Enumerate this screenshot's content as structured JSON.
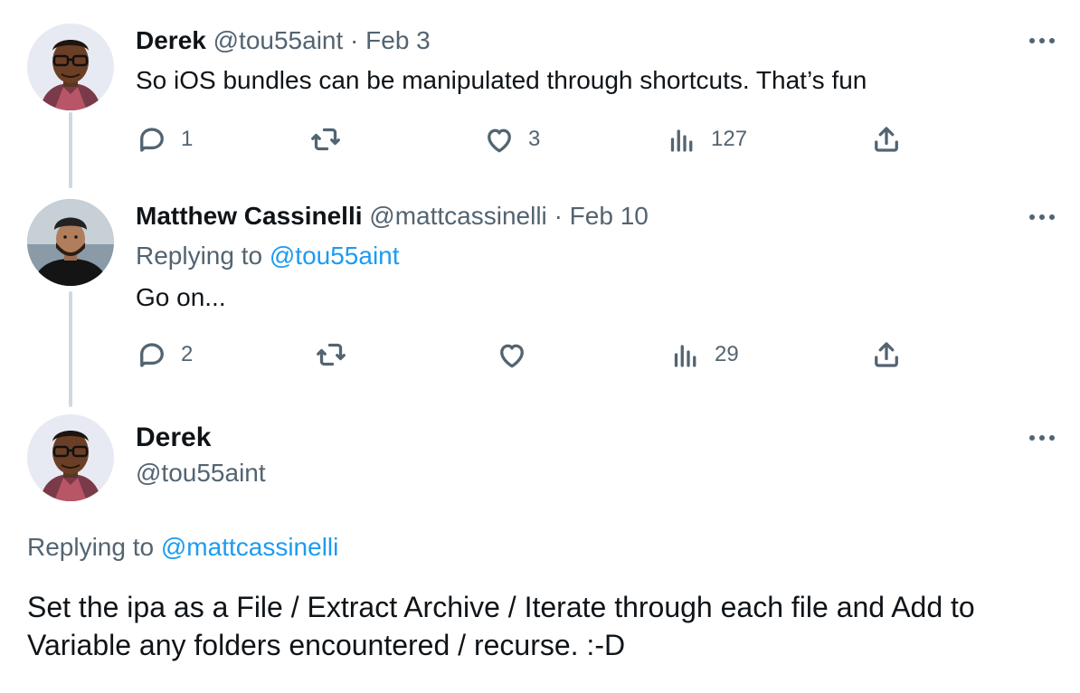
{
  "tweets": [
    {
      "name": "Derek",
      "handle": "@tou55aint",
      "separator": "·",
      "date": "Feb 3",
      "text": "So iOS bundles can be manipulated through shortcuts. That’s fun",
      "actions": {
        "replies": "1",
        "retweets": "",
        "likes": "3",
        "views": "127"
      }
    },
    {
      "name": "Matthew Cassinelli",
      "handle": "@mattcassinelli",
      "separator": "·",
      "date": "Feb 10",
      "replying_prefix": "Replying to",
      "replying_to": "@tou55aint",
      "text": "Go on...",
      "actions": {
        "replies": "2",
        "retweets": "",
        "likes": "",
        "views": "29"
      }
    }
  ],
  "main_tweet": {
    "name": "Derek",
    "handle": "@tou55aint",
    "replying_prefix": "Replying to",
    "replying_to": "@mattcassinelli",
    "text": "Set the ipa as a File / Extract Archive / Iterate through each file and Add to Variable any folders encountered / recurse. :-D"
  },
  "icons": [
    "reply-icon",
    "retweet-icon",
    "like-icon",
    "views-icon",
    "share-icon",
    "more-icon"
  ],
  "colors": {
    "text": "#0f1419",
    "muted": "#536471",
    "link": "#1d9bf0",
    "thread_line": "#cfd9de"
  }
}
